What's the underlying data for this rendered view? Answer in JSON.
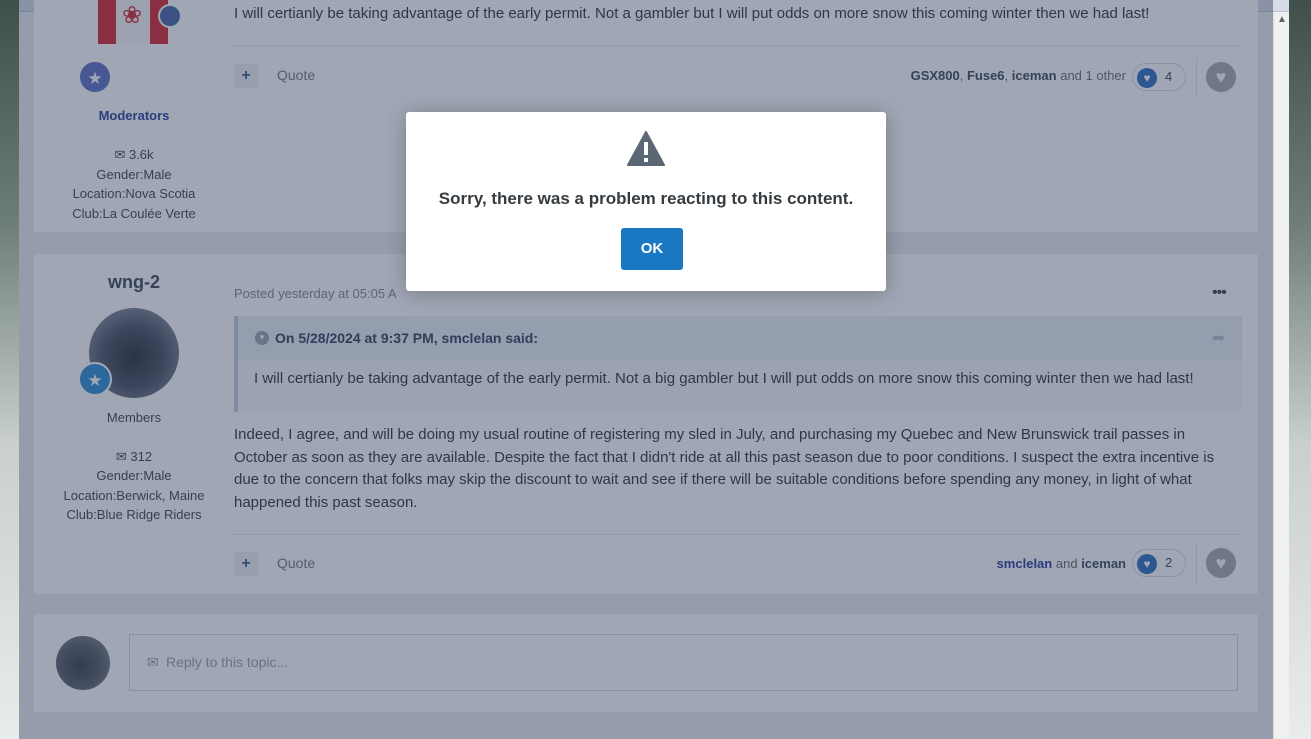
{
  "post1": {
    "snippet": "I will certianly be taking advantage of the early permit.  Not a gambler but I will put odds on more snow this coming winter then we had last!",
    "quote_label": "Quote",
    "reactors": {
      "names": [
        "GSX800",
        "Fuse6",
        "iceman"
      ],
      "suffix": "and 1 other"
    },
    "reaction_count": "4"
  },
  "author1": {
    "role": "Moderators",
    "posts": "3.6k",
    "gender": "Gender:Male",
    "location": "Location:Nova Scotia",
    "club": "Club:La Coulée Verte"
  },
  "post2": {
    "author": "wng-2",
    "role": "Members",
    "posts": "312",
    "gender": "Gender:Male",
    "location": "Location:Berwick, Maine",
    "club": "Club:Blue Ridge Riders",
    "posted": "Posted yesterday at 05:05 A",
    "quote_citation": "On 5/28/2024 at 9:37 PM, smclelan said:",
    "quote_text": "I will certianly be taking advantage of the early permit.  Not a big gambler but I will put odds on more snow this coming winter then we had last!",
    "body": "Indeed, I agree, and will be doing my usual routine of registering my sled in July, and purchasing my Quebec and New Brunswick trail passes in October as soon as they are available. Despite the fact that I didn't ride at all this past season due to poor conditions. I suspect the extra incentive is due to the concern that folks may skip the discount to wait and see if there will be suitable conditions before spending any money, in light of what happened this past season.",
    "quote_label": "Quote",
    "reactors": {
      "first": "smclelan",
      "joiner": "and",
      "second": "iceman"
    },
    "reaction_count": "2"
  },
  "reply": {
    "placeholder": "Reply to this topic..."
  },
  "dialog": {
    "message": "Sorry, there was a problem reacting to this content.",
    "ok_label": "OK"
  },
  "icons": {
    "warning": "warning-triangle-icon",
    "plus": "plus-icon",
    "like": "heart-icon",
    "comment": "comment-icon",
    "menu": "ellipsis-icon"
  },
  "colors": {
    "primary_button": "#1a78c2",
    "moderator_role": "#2f3e9c",
    "reaction_like": "#2d6fc0",
    "overlay": "#2c3a58"
  }
}
